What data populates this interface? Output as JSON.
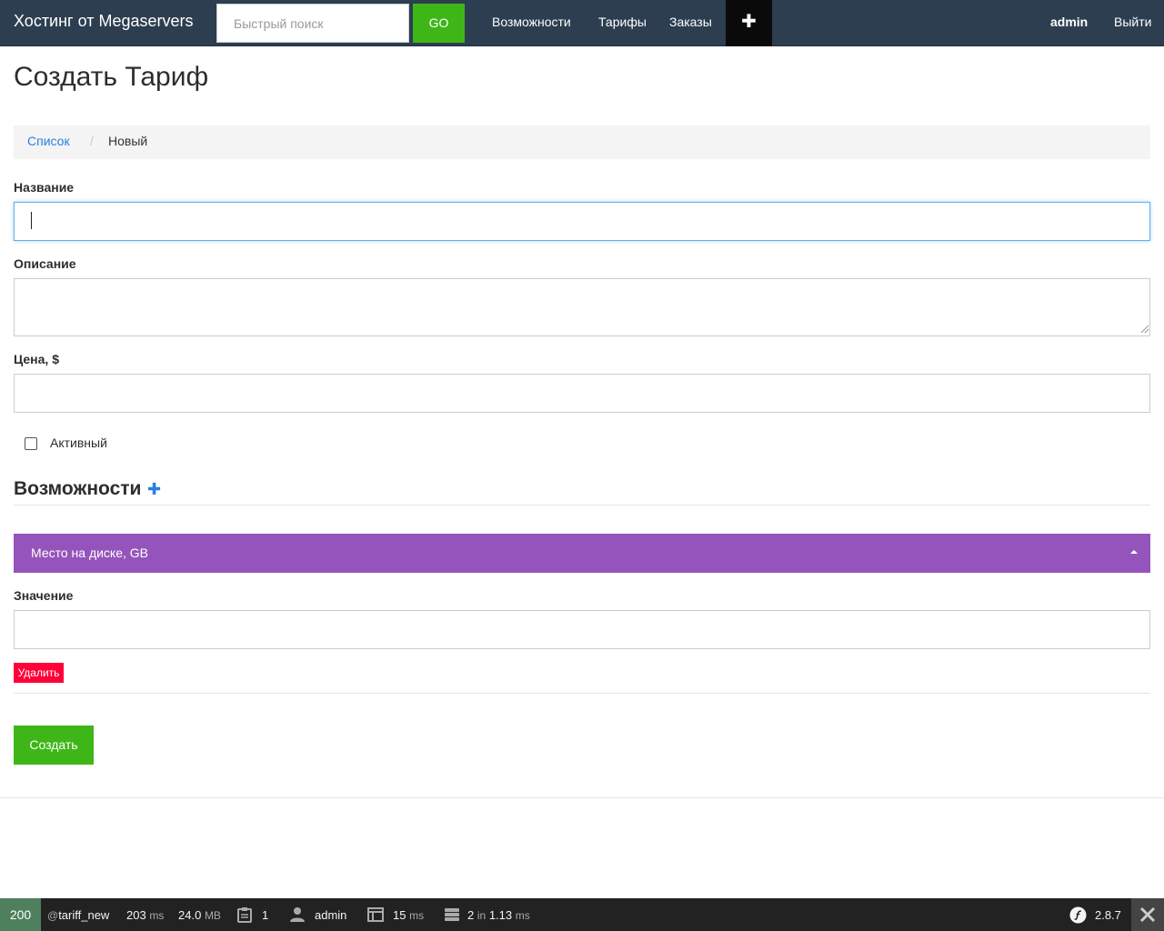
{
  "navbar": {
    "brand": "Хостинг от Megaservers",
    "search_placeholder": "Быстрый поиск",
    "go_label": "GO",
    "links": [
      "Возможности",
      "Тарифы",
      "Заказы"
    ],
    "plus_label": "✚",
    "user": "admin",
    "logout": "Выйти"
  },
  "page": {
    "title": "Создать Тариф",
    "breadcrumb": {
      "link": "Список",
      "separator": "/",
      "current": "Новый"
    }
  },
  "form": {
    "name_label": "Название",
    "name_value": "",
    "description_label": "Описание",
    "description_value": "",
    "price_label": "Цена, $",
    "price_value": "",
    "active_label": "Активный",
    "active_checked": false,
    "features_title": "Возможности",
    "features_add": "✚",
    "feature_panel_title": "Место на диске, GB",
    "value_label": "Значение",
    "value_value": "",
    "delete_label": "Удалить",
    "submit_label": "Создать"
  },
  "debug_toolbar": {
    "status": "200",
    "route": "tariff_new",
    "time": "203",
    "time_unit": "ms",
    "memory": "24.0",
    "memory_unit": "MB",
    "forms": "1",
    "user": "admin",
    "render_time": "15",
    "render_unit": "ms",
    "db_queries": "2",
    "db_in": "in",
    "db_time": "1.13",
    "db_unit": "ms",
    "version": "2.8.7"
  },
  "colors": {
    "navbar": "#2c3e50",
    "success": "#3fb618",
    "primary": "#2780e3",
    "purple": "#9554bb",
    "danger": "#ff0039",
    "toolbar": "#222222",
    "status_ok": "#4f805d"
  }
}
